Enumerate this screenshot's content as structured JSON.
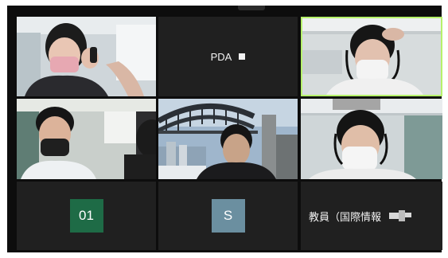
{
  "meeting": {
    "tiles": {
      "pda": {
        "label": "PDA"
      },
      "avatar_01": {
        "initials": "01",
        "color": "#1e6b46"
      },
      "avatar_s": {
        "initials": "S",
        "color": "#6b8fa0"
      },
      "teacher": {
        "label": "教員（国際情報"
      }
    },
    "active_speaker_border": "#b6f26b",
    "tile_background": "#202020",
    "window_background": "#0d0d0d"
  }
}
